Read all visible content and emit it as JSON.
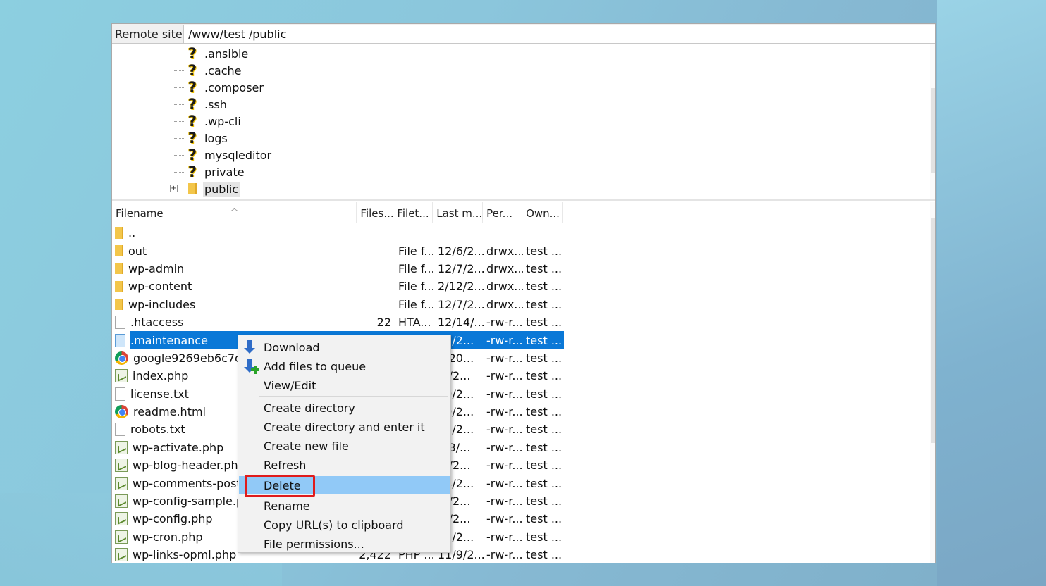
{
  "remote_site": {
    "label": "Remote site:",
    "path": "/www/test /public"
  },
  "tree": {
    "items": [
      {
        "label": ".ansible",
        "icon": "unknown-folder-icon"
      },
      {
        "label": ".cache",
        "icon": "unknown-folder-icon"
      },
      {
        "label": ".composer",
        "icon": "unknown-folder-icon"
      },
      {
        "label": ".ssh",
        "icon": "unknown-folder-icon"
      },
      {
        "label": ".wp-cli",
        "icon": "unknown-folder-icon"
      },
      {
        "label": "logs",
        "icon": "unknown-folder-icon"
      },
      {
        "label": "mysqleditor",
        "icon": "unknown-folder-icon"
      },
      {
        "label": "private",
        "icon": "unknown-folder-icon"
      },
      {
        "label": "public",
        "icon": "folder-icon",
        "expander": "+"
      }
    ]
  },
  "columns": {
    "filename": "Filename",
    "filesize": "Files...",
    "filetype": "Filet...",
    "modified": "Last m...",
    "permissions": "Per...",
    "owner": "Own..."
  },
  "files": [
    {
      "name": "..",
      "icon": "folder-icon",
      "size": "",
      "type": "",
      "modified": "",
      "perm": "",
      "owner": ""
    },
    {
      "name": "out",
      "icon": "folder-icon",
      "size": "",
      "type": "File f...",
      "modified": "12/6/2...",
      "perm": "drwx...",
      "owner": "test ..."
    },
    {
      "name": "wp-admin",
      "icon": "folder-icon",
      "size": "",
      "type": "File f...",
      "modified": "12/7/2...",
      "perm": "drwx...",
      "owner": "test ..."
    },
    {
      "name": "wp-content",
      "icon": "folder-icon",
      "size": "",
      "type": "File f...",
      "modified": "2/12/2...",
      "perm": "drwx...",
      "owner": "test ..."
    },
    {
      "name": "wp-includes",
      "icon": "folder-icon",
      "size": "",
      "type": "File f...",
      "modified": "12/7/2...",
      "perm": "drwx...",
      "owner": "test ..."
    },
    {
      "name": ".htaccess",
      "icon": "file-icon",
      "size": "22",
      "type": "HTA...",
      "modified": "12/14/...",
      "perm": "-rw-r...",
      "owner": "test ..."
    },
    {
      "name": ".maintenance",
      "icon": "file-blue-icon",
      "size": "",
      "type": "",
      "modified": "12/2...",
      "perm": "-rw-r...",
      "owner": "test ...",
      "selected": true
    },
    {
      "name": "google9269eb6c7c4",
      "icon": "chrome-icon",
      "size": "",
      "type": "",
      "modified": "4/20...",
      "perm": "-rw-r...",
      "owner": "test ..."
    },
    {
      "name": "index.php",
      "icon": "php-file-icon",
      "size": "",
      "type": "",
      "modified": "/9/2...",
      "perm": "-rw-r...",
      "owner": "test ..."
    },
    {
      "name": "license.txt",
      "icon": "file-icon",
      "size": "",
      "type": "",
      "modified": "10/2...",
      "perm": "-rw-r...",
      "owner": "test ..."
    },
    {
      "name": "readme.html",
      "icon": "chrome-icon",
      "size": "",
      "type": "",
      "modified": "10/2...",
      "perm": "-rw-r...",
      "owner": "test ..."
    },
    {
      "name": "robots.txt",
      "icon": "file-icon",
      "size": "",
      "type": "",
      "modified": "23/2...",
      "perm": "-rw-r...",
      "owner": "test ..."
    },
    {
      "name": "wp-activate.php",
      "icon": "php-file-icon",
      "size": "",
      "type": "",
      "modified": "/13/...",
      "perm": "-rw-r...",
      "owner": "test ..."
    },
    {
      "name": "wp-blog-header.php",
      "icon": "php-file-icon",
      "size": "",
      "type": "",
      "modified": "/9/2...",
      "perm": "-rw-r...",
      "owner": "test ..."
    },
    {
      "name": "wp-comments-post.",
      "icon": "php-file-icon",
      "size": "",
      "type": "",
      "modified": "24/2...",
      "perm": "-rw-r...",
      "owner": "test ..."
    },
    {
      "name": "wp-config-sample.p",
      "icon": "php-file-icon",
      "size": "",
      "type": "",
      "modified": "/9/2...",
      "perm": "-rw-r...",
      "owner": "test ..."
    },
    {
      "name": "wp-config.php",
      "icon": "php-file-icon",
      "size": "",
      "type": "",
      "modified": "/9/2...",
      "perm": "-rw-r...",
      "owner": "test ..."
    },
    {
      "name": "wp-cron.php",
      "icon": "php-file-icon",
      "size": "",
      "type": "",
      "modified": "25/2...",
      "perm": "-rw-r...",
      "owner": "test ..."
    },
    {
      "name": "wp-links-opml.php",
      "icon": "php-file-icon",
      "size": "2,422",
      "type": "PHP ...",
      "modified": "11/9/2...",
      "perm": "-rw-r...",
      "owner": "test ..."
    }
  ],
  "context_menu": {
    "items": [
      {
        "label": "Download",
        "icon": "download-arrow-icon"
      },
      {
        "label": "Add files to queue",
        "icon": "add-to-queue-icon"
      },
      {
        "label": "View/Edit"
      },
      {
        "label": "Create directory"
      },
      {
        "label": "Create directory and enter it"
      },
      {
        "label": "Create new file"
      },
      {
        "label": "Refresh"
      },
      {
        "label": "Delete",
        "highlighted": true
      },
      {
        "label": "Rename"
      },
      {
        "label": "Copy URL(s) to clipboard"
      },
      {
        "label": "File permissions..."
      }
    ]
  },
  "colors": {
    "selection": "#0a78d7",
    "menu_highlight": "#91c9f7",
    "annotation_box": "#e01b1b"
  }
}
